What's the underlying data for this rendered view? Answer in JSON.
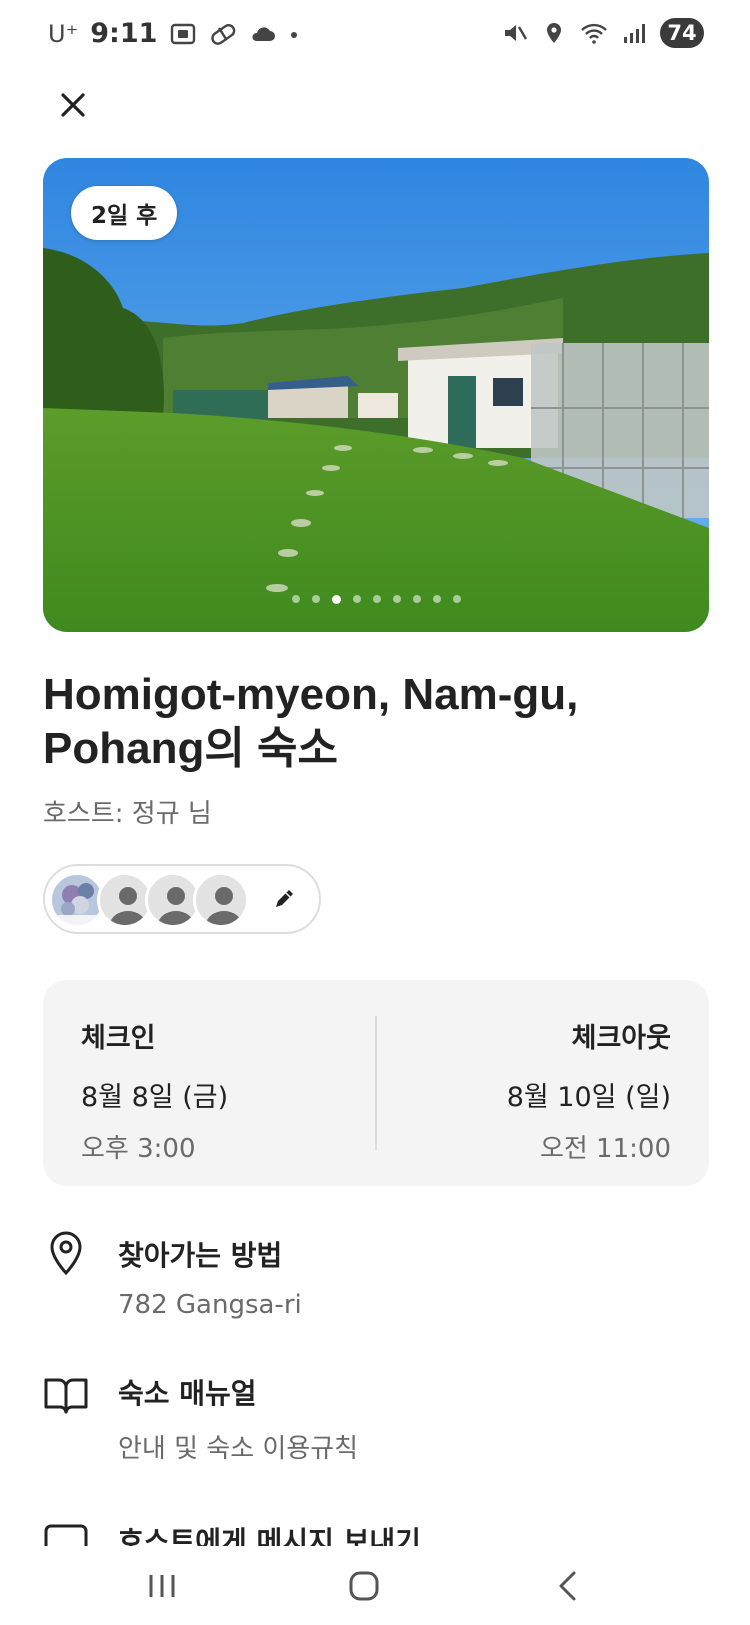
{
  "status_bar": {
    "carrier": "U⁺",
    "time": "9:11",
    "battery": "74",
    "icons": [
      "screenshot-icon",
      "pill-icon",
      "cloud-icon",
      "dot-icon",
      "mute-icon",
      "location-icon",
      "wifi-icon",
      "signal-icon"
    ]
  },
  "header": {
    "close_icon": "close-icon"
  },
  "hero": {
    "badge": "2일 후",
    "photo_count": 9,
    "active_photo_index": 2
  },
  "listing": {
    "title": "Homigot-myeon, Nam-gu, Pohang의 숙소",
    "host": "호스트: 정규 님"
  },
  "guests": {
    "avatars": [
      "guest-photo-avatar",
      "guest-placeholder-avatar",
      "guest-placeholder-avatar",
      "guest-placeholder-avatar"
    ],
    "edit_icon": "pencil-icon"
  },
  "checkin": {
    "in_label": "체크인",
    "in_date": "8월 8일 (금)",
    "in_time": "오후 3:00",
    "out_label": "체크아웃",
    "out_date": "8월 10일 (일)",
    "out_time": "오전 11:00"
  },
  "rows": [
    {
      "icon": "location-pin-icon",
      "title": "찾아가는 방법",
      "subtitle": "782 Gangsa-ri"
    },
    {
      "icon": "book-icon",
      "title": "숙소 매뉴얼",
      "subtitle": "안내 및 숙소 이용규칙"
    },
    {
      "icon": "message-icon",
      "title": "호스트에게 메시지 보내기"
    }
  ],
  "nav": {
    "icons": [
      "recent-apps-icon",
      "home-icon",
      "back-icon"
    ]
  },
  "colors": {
    "text": "#222222",
    "muted": "#6a6a6a",
    "card_bg": "#f4f4f4",
    "border": "#dddddd"
  }
}
